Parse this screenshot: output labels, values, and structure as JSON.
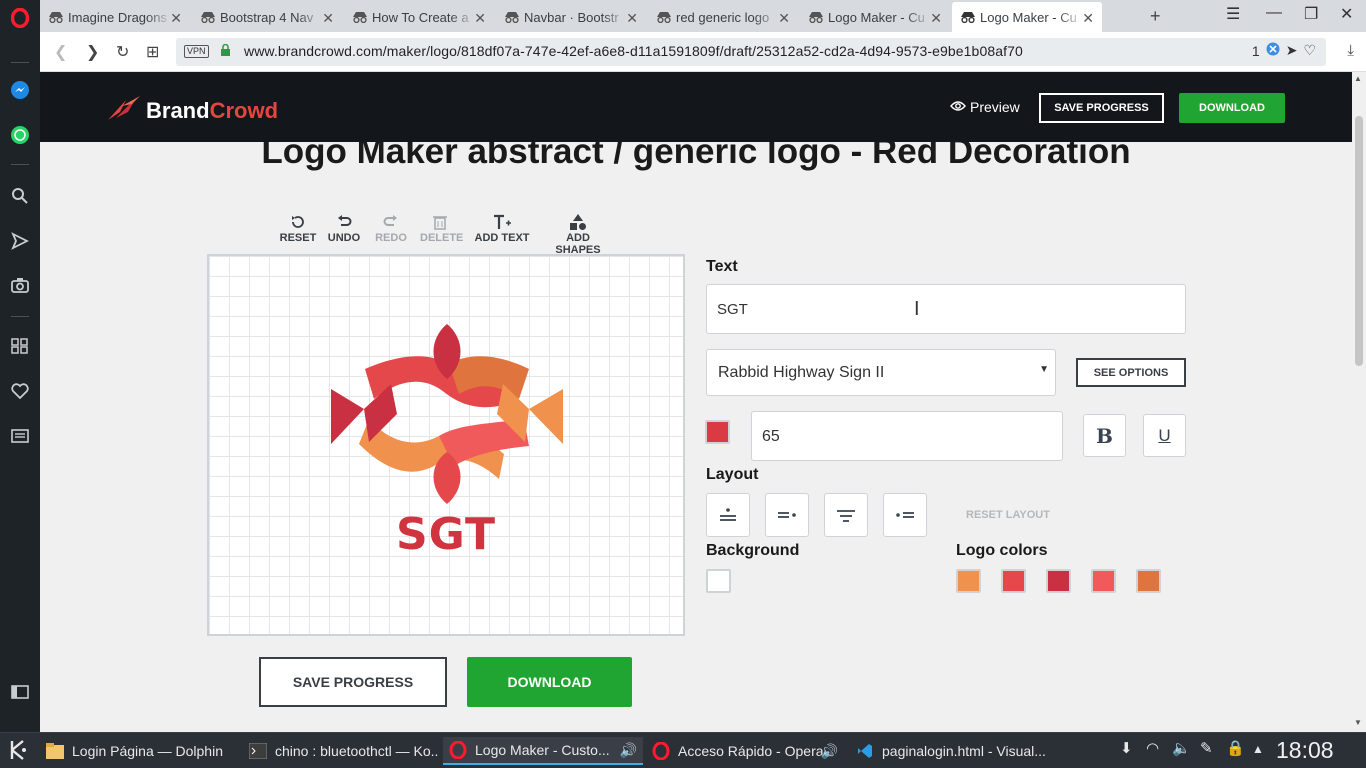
{
  "browser": {
    "tabs": [
      {
        "title": "Imagine Dragons"
      },
      {
        "title": "Bootstrap 4 Nav"
      },
      {
        "title": "How To Create a"
      },
      {
        "title": "Navbar · Bootstr"
      },
      {
        "title": "red generic logo"
      },
      {
        "title": "Logo Maker - Cu"
      },
      {
        "title": "Logo Maker - Cu"
      }
    ],
    "vpn_label": "VPN",
    "url": "www.brandcrowd.com/maker/logo/818df07a-747e-42ef-a6e8-d11a1591809f/draft/25312a52-cd2a-4d94-9573-e9be1b08af70",
    "tracker_count": "1"
  },
  "site": {
    "logo_brand": "Brand",
    "logo_crowd": "Crowd",
    "preview_label": "Preview",
    "save_progress_label": "SAVE PROGRESS",
    "download_label": "DOWNLOAD"
  },
  "page": {
    "title": "Logo Maker abstract / generic logo - Red Decoration"
  },
  "toolbar": {
    "reset": "RESET",
    "undo": "UNDO",
    "redo": "REDO",
    "delete": "DELETE",
    "add_text": "ADD TEXT",
    "add_shapes": "ADD SHAPES"
  },
  "canvas": {
    "brand_text": "SGT"
  },
  "actions": {
    "save_progress": "SAVE PROGRESS",
    "download": "DOWNLOAD"
  },
  "editor": {
    "text_label": "Text",
    "text_value": "SGT",
    "font_value": "Rabbid Highway Sign II",
    "see_options": "SEE OPTIONS",
    "text_color": "#d93a44",
    "font_size": "65",
    "bold_glyph": "B",
    "underline_glyph": "U",
    "layout_label": "Layout",
    "reset_layout": "RESET LAYOUT",
    "background_label": "Background",
    "logo_colors_label": "Logo colors",
    "background_color": "#ffffff",
    "logo_colors": [
      "#f0924e",
      "#e5484a",
      "#c93042",
      "#f05a5b",
      "#e0743e"
    ]
  },
  "taskbar": {
    "tasks": [
      {
        "title": "Login Página — Dolphin"
      },
      {
        "title": "chino : bluetoothctl — Ko..."
      },
      {
        "title": "Logo Maker - Custo..."
      },
      {
        "title": "Acceso Rápido - Opera"
      },
      {
        "title": "paginalogin.html - Visual..."
      }
    ],
    "clock": "18:08"
  }
}
